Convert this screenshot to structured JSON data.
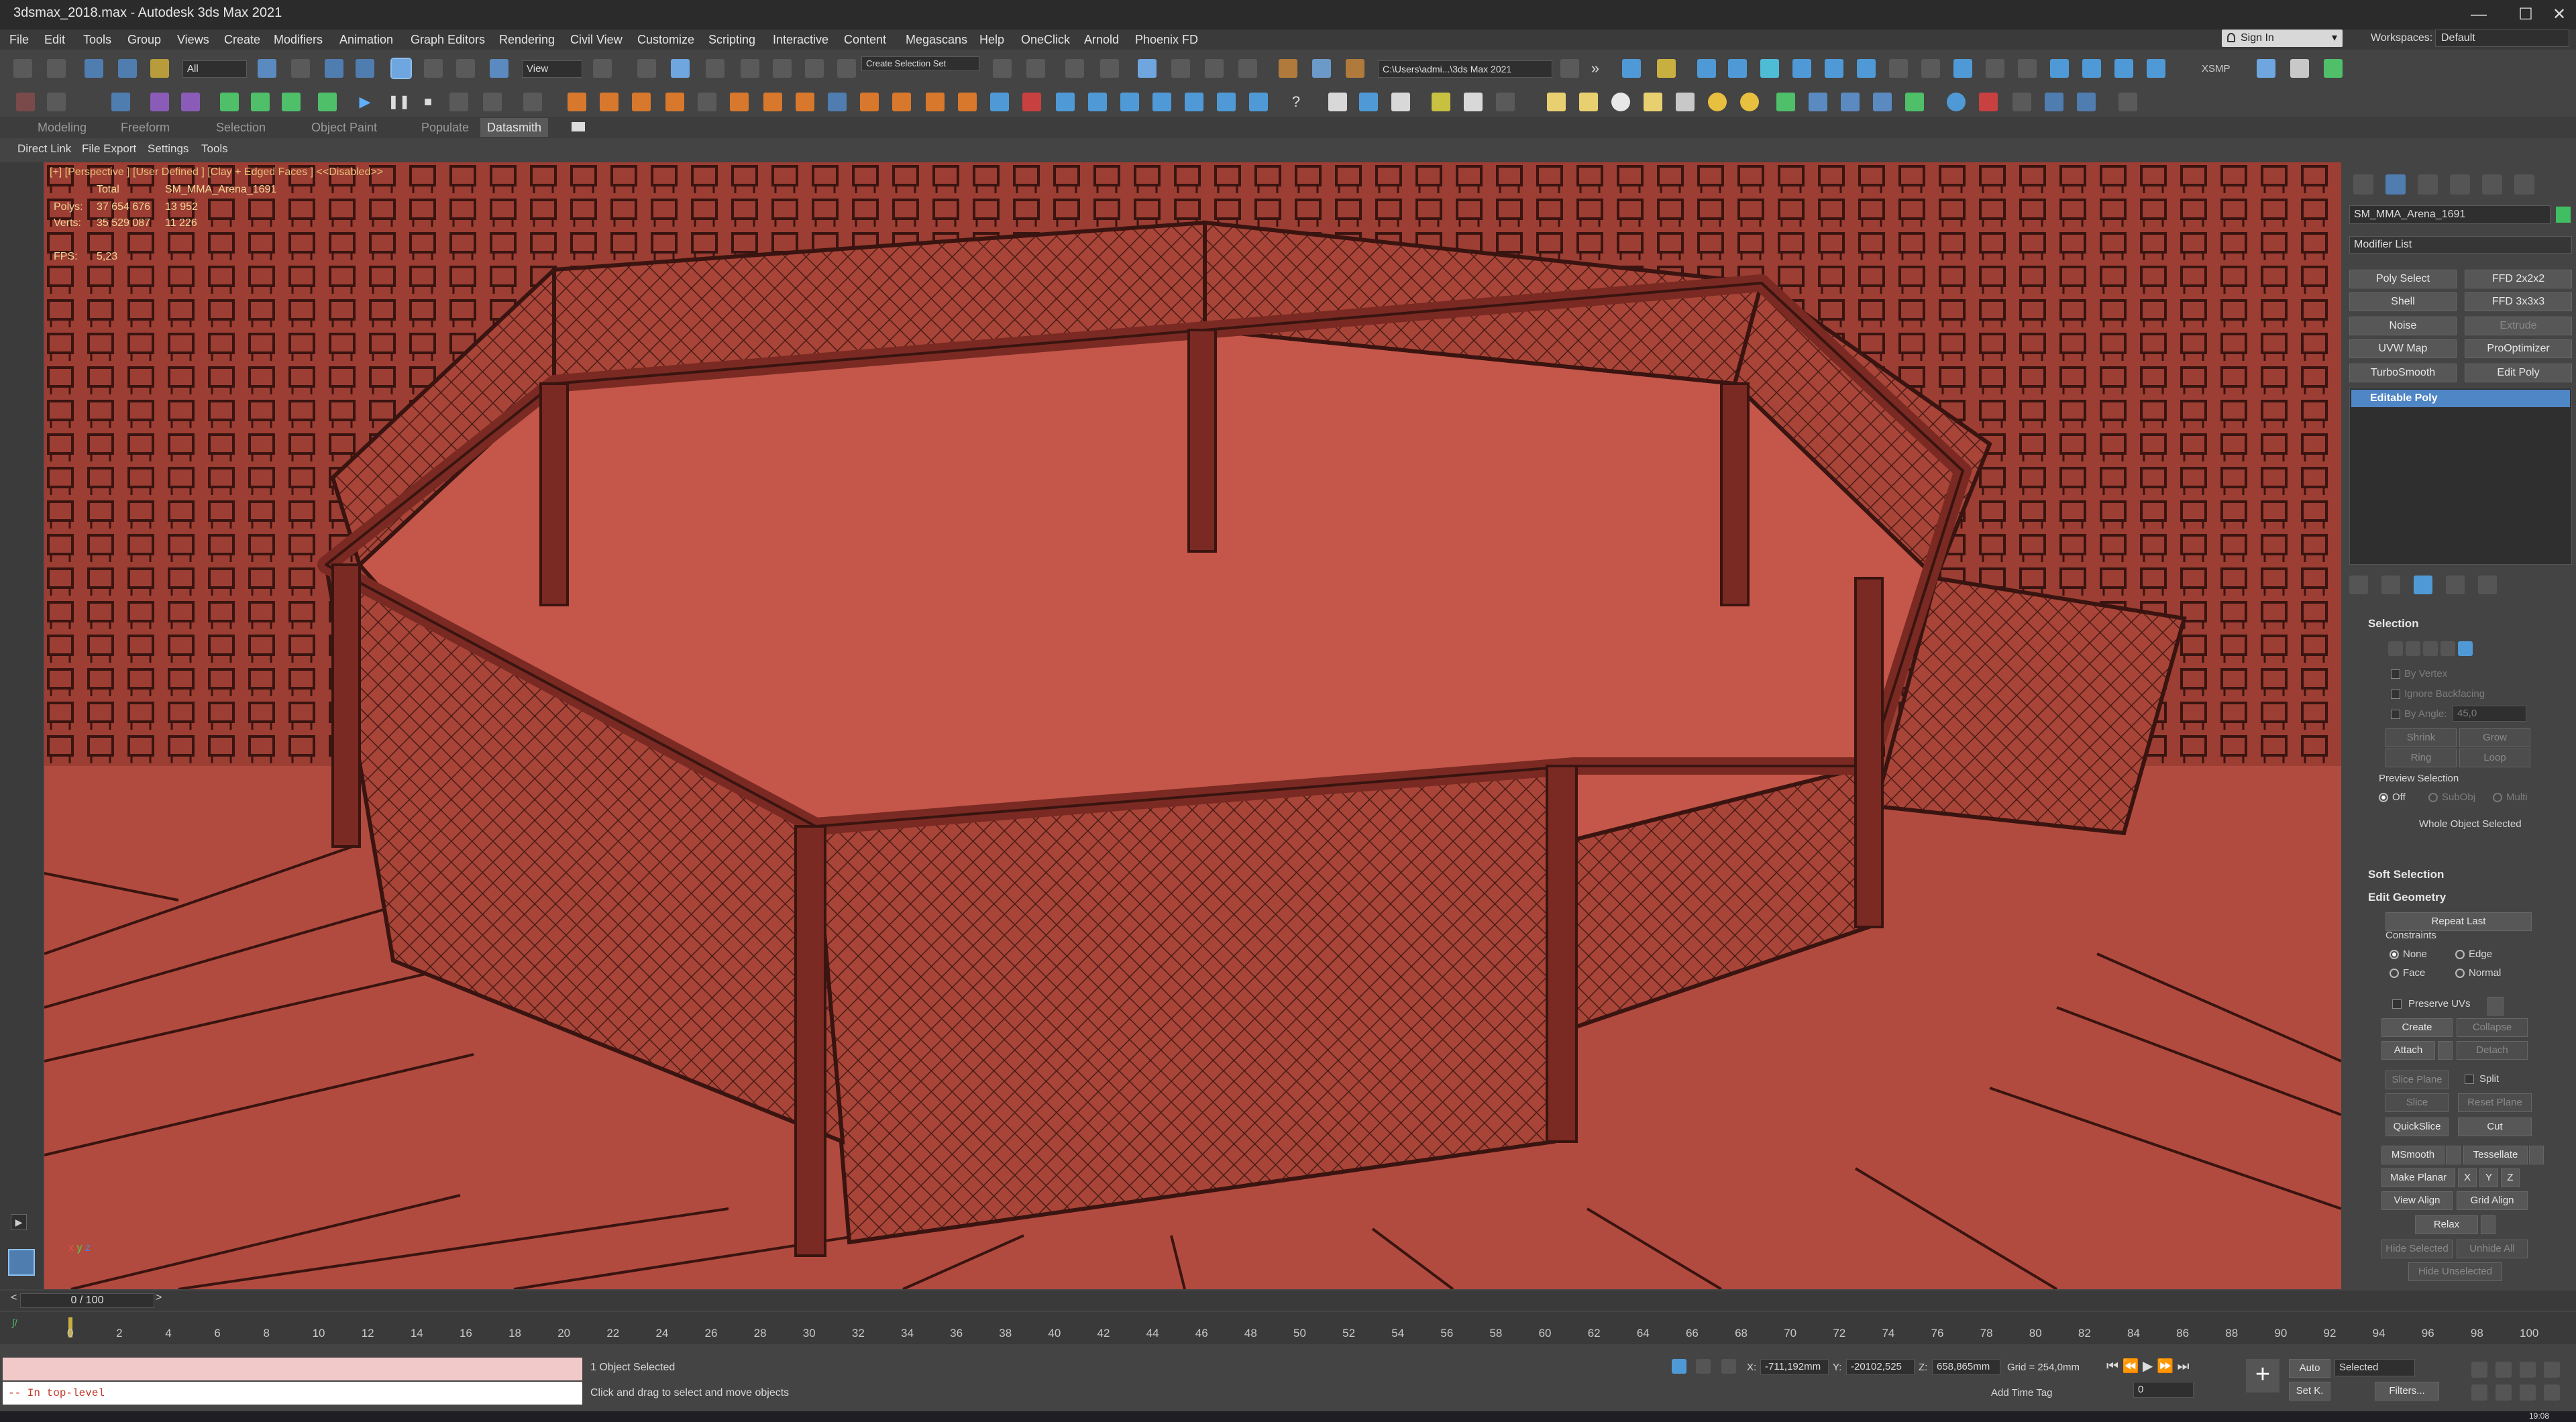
{
  "window": {
    "title": "3dsmax_2018.max - Autodesk 3ds Max 2021",
    "minimize": "—",
    "maximize": "☐",
    "close": "✕"
  },
  "menu": [
    "File",
    "Edit",
    "Tools",
    "Group",
    "Views",
    "Create",
    "Modifiers",
    "Animation",
    "Graph Editors",
    "Rendering",
    "Civil View",
    "Customize",
    "Scripting",
    "Interactive",
    "Content",
    "Megascans",
    "Help",
    "OneClick",
    "Arnold",
    "Phoenix FD"
  ],
  "signin": {
    "label": "Sign In"
  },
  "workspaces": {
    "label": "Workspaces:",
    "value": "Default"
  },
  "toolbar": {
    "selection_filter": "All",
    "ref_coord": "View",
    "named_selection": "Create Selection Set",
    "project_path": "C:\\Users\\admi...\\3ds Max 2021",
    "xsmp": "XSMP"
  },
  "ribbon": {
    "tabs": [
      "Modeling",
      "Freeform",
      "Selection",
      "Object Paint",
      "Populate",
      "Datasmith"
    ],
    "active": "Datasmith",
    "subtabs": [
      "Direct Link",
      "File Export",
      "Settings",
      "Tools"
    ]
  },
  "viewport": {
    "label": "[+] [Perspective ] [User Defined ] [Clay + Edged Faces ]  <<Disabled>>",
    "stats": {
      "col_total": "Total",
      "col_object": "SM_MMA_Arena_1691",
      "polys_label": "Polys:",
      "polys_total": "37 654 676",
      "polys_object": "13 952",
      "verts_label": "Verts:",
      "verts_total": "35 529 087",
      "verts_object": "11 226",
      "fps_label": "FPS:",
      "fps_value": "5,23"
    },
    "axis": {
      "x": "x",
      "y": "y",
      "z": "z"
    }
  },
  "command_panel": {
    "object_name": "SM_MMA_Arena_1691",
    "object_color": "#3fbf62",
    "modifier_list": "Modifier List",
    "modifier_buttons": [
      "Poly Select",
      "FFD 2x2x2",
      "Shell",
      "FFD 3x3x3",
      "Noise",
      "Extrude",
      "UVW Map",
      "ProOptimizer",
      "TurboSmooth",
      "Edit Poly"
    ],
    "stack_item": "Editable Poly",
    "selection": {
      "title": "Selection",
      "by_vertex": "By Vertex",
      "ignore_backfacing": "Ignore Backfacing",
      "by_angle": "By Angle:",
      "angle_value": "45,0",
      "shrink": "Shrink",
      "grow": "Grow",
      "ring": "Ring",
      "loop": "Loop",
      "preview_selection": "Preview Selection",
      "off": "Off",
      "subobj": "SubObj",
      "multi": "Multi",
      "status": "Whole Object Selected"
    },
    "soft_selection": "Soft Selection",
    "edit_geometry": {
      "title": "Edit Geometry",
      "repeat_last": "Repeat Last",
      "constraints": "Constraints",
      "none": "None",
      "edge": "Edge",
      "face": "Face",
      "normal": "Normal",
      "preserve_uvs": "Preserve UVs",
      "create": "Create",
      "collapse": "Collapse",
      "attach": "Attach",
      "detach": "Detach",
      "slice_plane": "Slice Plane",
      "split": "Split",
      "slice": "Slice",
      "reset_plane": "Reset Plane",
      "quickslice": "QuickSlice",
      "cut": "Cut",
      "msmooth": "MSmooth",
      "tessellate": "Tessellate",
      "make_planar": "Make Planar",
      "x": "X",
      "y": "Y",
      "z": "Z",
      "view_align": "View Align",
      "grid_align": "Grid Align",
      "relax": "Relax",
      "hide_selected": "Hide Selected",
      "unhide_all": "Unhide All",
      "hide_unselected": "Hide Unselected"
    }
  },
  "timeline": {
    "frame": "0 / 100",
    "prev": "<",
    "next": ">",
    "ticks": [
      "0",
      "2",
      "4",
      "6",
      "8",
      "10",
      "12",
      "14",
      "16",
      "18",
      "20",
      "22",
      "24",
      "26",
      "28",
      "30",
      "32",
      "34",
      "36",
      "38",
      "40",
      "42",
      "44",
      "46",
      "48",
      "50",
      "52",
      "54",
      "56",
      "58",
      "60",
      "62",
      "64",
      "66",
      "68",
      "70",
      "72",
      "74",
      "76",
      "78",
      "80",
      "82",
      "84",
      "86",
      "88",
      "90",
      "92",
      "94",
      "96",
      "98",
      "100"
    ]
  },
  "status": {
    "maxscript": "-- In top-level",
    "selected": "1 Object Selected",
    "prompt": "Click and drag to select and move objects",
    "x_label": "X:",
    "x_value": "-711,192mm",
    "y_label": "Y:",
    "y_value": "-20102,525",
    "z_label": "Z:",
    "z_value": "658,865mm",
    "grid": "Grid = 254,0mm",
    "add_time_tag": "Add Time Tag",
    "auto": "Auto",
    "set_key": "Set K.",
    "key_filter": "Selected",
    "filters": "Filters...",
    "frame_field": "0"
  },
  "taskbar": {
    "clock": "19:08"
  }
}
